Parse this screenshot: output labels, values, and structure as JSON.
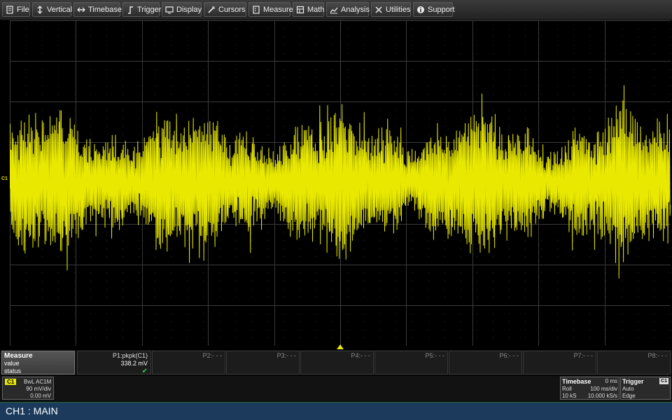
{
  "menu": {
    "items": [
      {
        "label": "File",
        "icon": "file-icon"
      },
      {
        "label": "Vertical",
        "icon": "vertical-icon"
      },
      {
        "label": "Timebase",
        "icon": "timebase-icon"
      },
      {
        "label": "Trigger",
        "icon": "trigger-icon"
      },
      {
        "label": "Display",
        "icon": "display-icon"
      },
      {
        "label": "Cursors",
        "icon": "cursors-icon"
      },
      {
        "label": "Measure",
        "icon": "measure-icon"
      },
      {
        "label": "Math",
        "icon": "math-icon"
      },
      {
        "label": "Analysis",
        "icon": "analysis-icon"
      },
      {
        "label": "Utilities",
        "icon": "utilities-icon"
      },
      {
        "label": "Support",
        "icon": "support-icon"
      }
    ]
  },
  "screen": {
    "channel_marker": "C1",
    "trace_color": "#e8e800",
    "grid": {
      "h_divisions": 10,
      "v_divisions": 8
    }
  },
  "measure": {
    "header": "Measure",
    "row_value": "value",
    "row_status": "status",
    "params": [
      {
        "label": "P1:pkpk(C1)",
        "value": "338.2 mV",
        "status": "✔"
      },
      {
        "label": "P2:- - -",
        "value": "",
        "status": ""
      },
      {
        "label": "P3:- - -",
        "value": "",
        "status": ""
      },
      {
        "label": "P4:- - -",
        "value": "",
        "status": ""
      },
      {
        "label": "P5:- - -",
        "value": "",
        "status": ""
      },
      {
        "label": "P6:- - -",
        "value": "",
        "status": ""
      },
      {
        "label": "P7:- - -",
        "value": "",
        "status": ""
      },
      {
        "label": "P8:- - -",
        "value": "",
        "status": ""
      }
    ]
  },
  "channel1": {
    "badge": "C1",
    "coupling": "BwL AC1M",
    "scale": "90 mV/div",
    "offset": "0.00 mV"
  },
  "timebase": {
    "title": "Timebase",
    "delay": "0 ms",
    "mode": "Roll",
    "scale": "100 ms/div",
    "samples": "10 kS",
    "rate": "10.000 kS/s"
  },
  "trigger": {
    "title": "Trigger",
    "source": "C1",
    "mode": "Auto",
    "type": "Edge"
  },
  "status": {
    "text": "CH1 : MAIN"
  }
}
